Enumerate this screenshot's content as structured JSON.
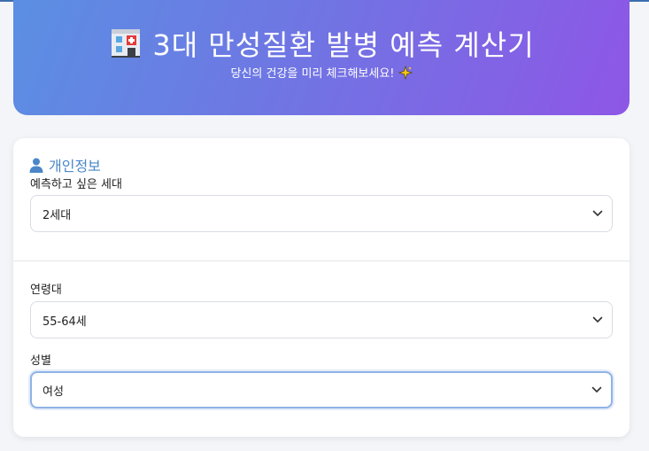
{
  "header": {
    "title": "3대 만성질환 발병 예측 계산기",
    "subtitle": "당신의 건강을 미리 체크해보세요!",
    "title_icon": "hospital-icon",
    "subtitle_icon": "sparkle-icon"
  },
  "personal_info": {
    "section_title": "개인정보",
    "section_icon": "person-icon",
    "generation": {
      "label": "예측하고 싶은 세대",
      "value": "2세대"
    },
    "age_group": {
      "label": "연령대",
      "value": "55-64세"
    },
    "gender": {
      "label": "성별",
      "value": "여성"
    }
  },
  "colors": {
    "header_gradient_start": "#5b8fe3",
    "header_gradient_end": "#8e56e6",
    "section_title": "#4a86c8",
    "focus_border": "#8fb3e6"
  }
}
